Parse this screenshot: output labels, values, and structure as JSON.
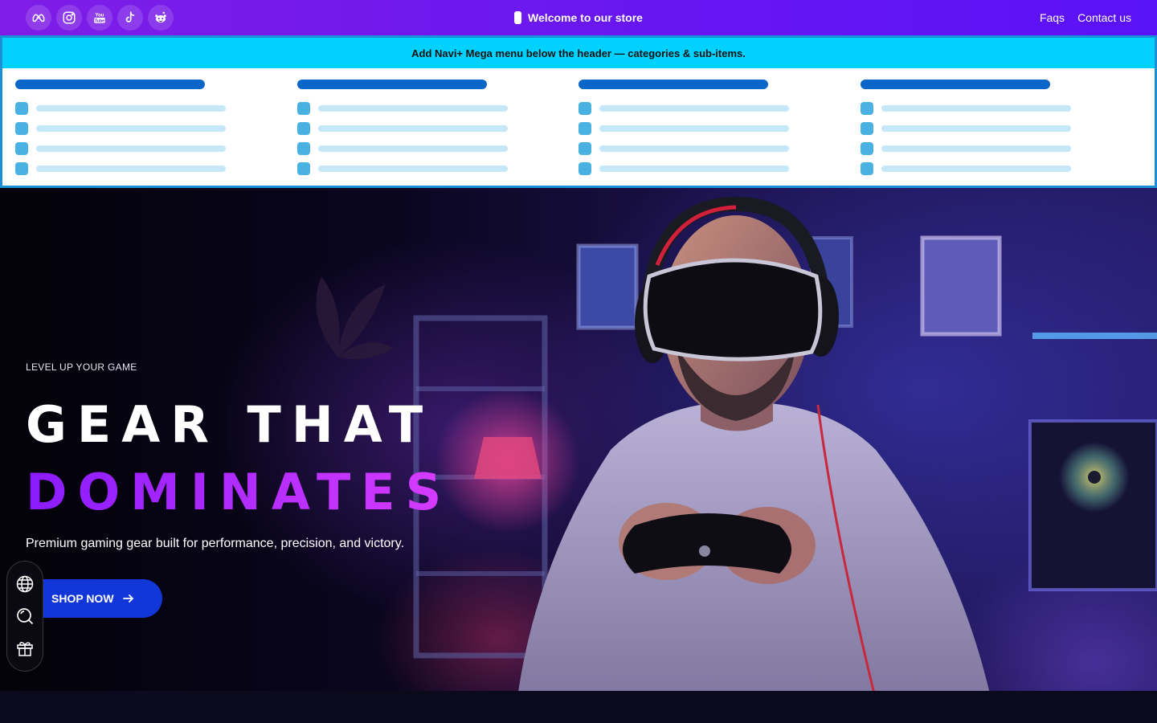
{
  "topbar": {
    "socials": [
      {
        "icon": "meta-icon"
      },
      {
        "icon": "instagram-icon"
      },
      {
        "icon": "youtube-icon",
        "label": "You Tube"
      },
      {
        "icon": "tiktok-icon"
      },
      {
        "icon": "reddit-icon"
      }
    ],
    "announcement": "Welcome to our store",
    "links": {
      "faqs": "Faqs",
      "contact": "Contact us"
    }
  },
  "mega_menu": {
    "notice": "Add Navi+ Mega menu below the header — categories & sub-items.",
    "columns": 4,
    "rows_per_column": 4
  },
  "hero": {
    "eyebrow": "LEVEL UP YOUR GAME",
    "title_line1": "GEAR THAT",
    "title_line2": "DOMINATES",
    "subtitle": "Premium gaming gear built for performance, precision, and victory.",
    "cta_label": "SHOP NOW",
    "cta_icon": "arrow-right-icon"
  },
  "dock": {
    "items": [
      {
        "icon": "globe-icon"
      },
      {
        "icon": "search-icon"
      },
      {
        "icon": "gift-icon"
      }
    ]
  },
  "colors": {
    "topbar_start": "#7f1de6",
    "topbar_end": "#5a12f7",
    "mega_notice_bg": "#00d1ff",
    "mega_border": "#1a8fd8",
    "placeholder_head": "#0a66c8",
    "placeholder_line": "#c5e7f7",
    "placeholder_square": "#4ab2e2",
    "title_accent": "#b01cff",
    "cta_bg": "#1237d8"
  }
}
